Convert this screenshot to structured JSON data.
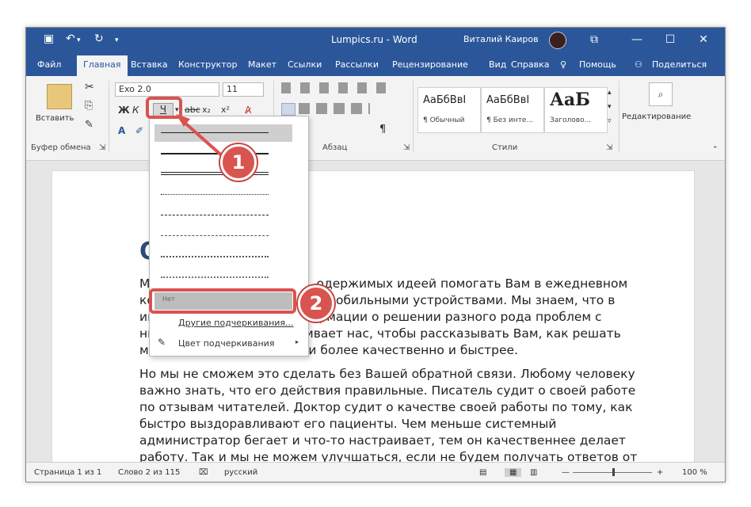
{
  "titlebar": {
    "title": "Lumpics.ru - Word",
    "user": "Виталий Каиров",
    "qa_icons": [
      "save-icon",
      "undo-icon",
      "redo-icon",
      "customize-icon"
    ]
  },
  "tabs": [
    "Файл",
    "Главная",
    "Вставка",
    "Конструктор",
    "Макет",
    "Ссылки",
    "Рассылки",
    "Рецензирование",
    "Вид",
    "Справка",
    "Помощь",
    "Поделиться"
  ],
  "ribbon": {
    "paste_label": "Вставить",
    "clipboard_label": "Буфер обмена",
    "font_name": "Exo 2.0",
    "font_size": "11",
    "paragraph_label": "Абзац",
    "styles_label": "Стили",
    "styles": [
      {
        "preview": "АаБбВвІ",
        "name": "¶ Обычный"
      },
      {
        "preview": "АаБбВвІ",
        "name": "¶ Без инте..."
      },
      {
        "preview": "АаБ",
        "name": "Заголово..."
      }
    ],
    "editing_label": "Редактирование",
    "bold": "Ж",
    "italic": "К",
    "underline": "Ч",
    "strike": "abc",
    "subscript": "x₂",
    "superscript": "x²"
  },
  "document": {
    "heading": "О",
    "paragraph1": [
      "Мы — группа энтузиастов, одержимых идеей помогать Вам в ежедневном",
      "контакте с компьютерами и мобильными устройствами. Мы знаем, что в",
      "интернете уже полно информации о решении разного рода проблем с",
      "ними. Но это не останавливает нас, чтобы рассказывать Вам, как решать",
      "многие проблемы и задачи более качественно и быстрее."
    ],
    "paragraph2": [
      "Но мы не сможем это сделать без Вашей обратной связи. Любому человеку",
      "важно знать, что его действия правильные. Писатель судит о своей работе",
      "по отзывам читателей. Доктор судит о качестве своей работы по тому, как",
      "быстро выздоравливают его пациенты. Чем меньше системный",
      "администратор бегает и что-то настраивает, тем он качественнее делает",
      "работу. Так и мы не можем улучшаться, если не будем получать ответов от"
    ]
  },
  "dropdown": {
    "none_label": "Нет",
    "other_label": "Другие подчеркивания...",
    "color_label": "Цвет подчеркивания"
  },
  "status": {
    "page": "Страница 1 из 1",
    "words": "Слово 2 из 115",
    "language": "русский",
    "zoom": "100 %"
  },
  "callouts": [
    "1",
    "2"
  ],
  "colors": {
    "accent": "#2b579a",
    "callout": "#d9534f"
  }
}
